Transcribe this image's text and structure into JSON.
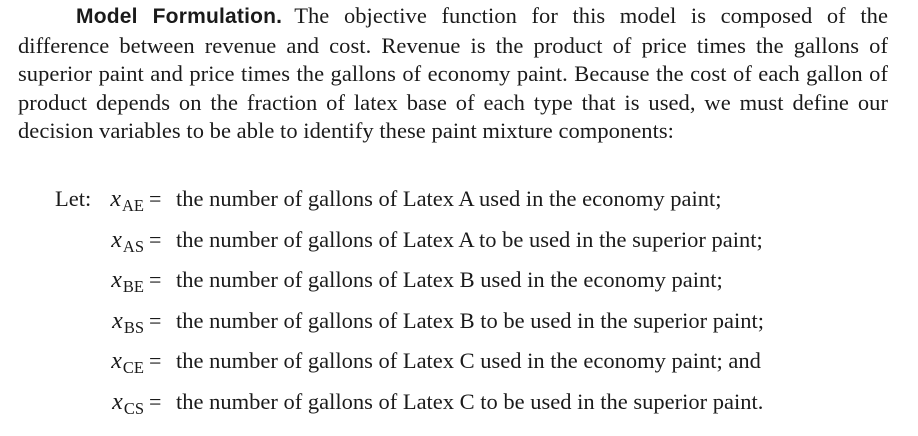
{
  "paragraph": {
    "run_in_heading": "Model Formulation.",
    "body": "The objective function for this model is composed of the difference between revenue and cost. Revenue is the product of price times the gallons of superior paint and price times the gallons of economy paint. Because the cost of each gallon of product depends on the fraction of latex base of each type that is used, we must define our decision variables to be able to identify these paint mixture components:"
  },
  "definitions": {
    "lead": "Let:",
    "equals_sign": "=",
    "items": [
      {
        "symbol": "x",
        "subscript": "AE",
        "description": "the number of gallons of Latex A used in the economy paint;"
      },
      {
        "symbol": "x",
        "subscript": "AS",
        "description": "the number of gallons of Latex A to be used in the superior paint;"
      },
      {
        "symbol": "x",
        "subscript": "BE",
        "description": "the number of gallons of Latex B used in the economy paint;"
      },
      {
        "symbol": "x",
        "subscript": "BS",
        "description": "the number of gallons of Latex B to be used in the superior paint;"
      },
      {
        "symbol": "x",
        "subscript": "CE",
        "description": "the number of gallons of Latex C used in the economy paint; and"
      },
      {
        "symbol": "x",
        "subscript": "CS",
        "description": "the number of gallons of Latex C to be used in the superior paint."
      }
    ]
  }
}
